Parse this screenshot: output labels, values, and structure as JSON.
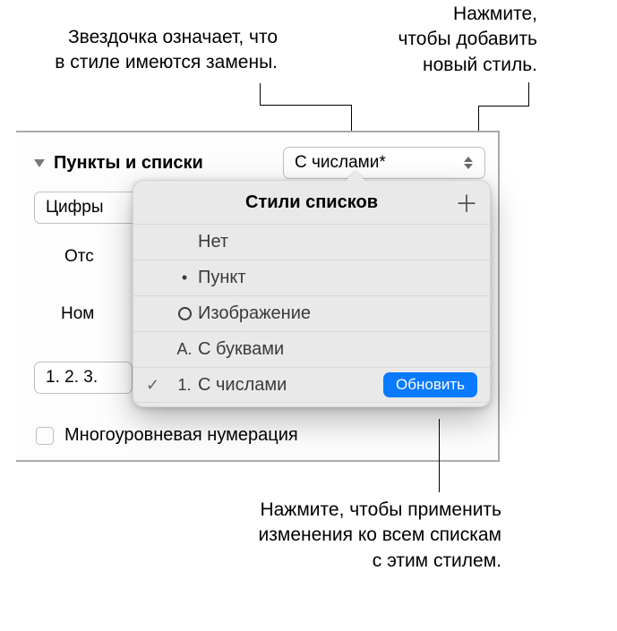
{
  "callouts": {
    "asterisk": "Звездочка означает, что\nв стиле имеются замены.",
    "add_style": "Нажмите,\nчтобы добавить\nновый стиль.",
    "update": "Нажмите, чтобы применить\nизменения ко всем спискам\nс этим стилем."
  },
  "panel": {
    "section_title": "Пункты и списки",
    "style_button_label": "С числами*",
    "numbers_label": "Цифры",
    "indent_label": "Отс",
    "number_label": "Ном",
    "hierarchy_label": "1. 2. 3.",
    "tiered": "Многоуровневая нумерация"
  },
  "popover": {
    "title": "Стили списков",
    "items": [
      {
        "marker": "",
        "label": "Нет",
        "selected": false
      },
      {
        "marker": "bullet",
        "label": "Пункт",
        "selected": false
      },
      {
        "marker": "image",
        "label": "Изображение",
        "selected": false
      },
      {
        "marker": "A.",
        "label": "С буквами",
        "selected": false
      },
      {
        "marker": "1.",
        "label": "С числами",
        "selected": true
      }
    ],
    "update_button": "Обновить"
  }
}
